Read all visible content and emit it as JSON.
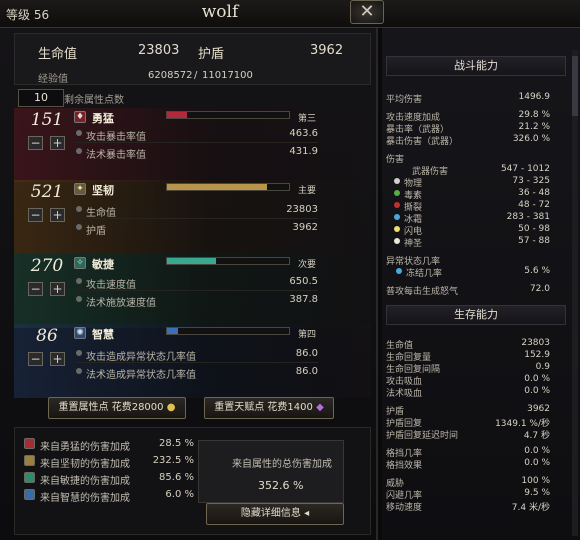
{
  "header": {
    "level_label": "等级 56",
    "char_name": "wolf",
    "close_label": "✕"
  },
  "summary": {
    "hp_label": "生命值",
    "hp_value": "23803",
    "shield_label": "护盾",
    "shield_value": "3962",
    "exp_label": "经验值",
    "exp_value": "6208572",
    "exp_sep": "/",
    "exp_next": "11017100",
    "free_points": "10",
    "free_points_label": "剩余属性点数"
  },
  "attributes": [
    {
      "value": "151",
      "name": "勇猛",
      "rank": "第三",
      "fill": 0.16,
      "color": "#b3283a",
      "icon": "rage-icon",
      "subs": [
        {
          "label": "攻击暴击率值",
          "value": "463.6"
        },
        {
          "label": "法术暴击率值",
          "value": "431.9"
        }
      ]
    },
    {
      "value": "521",
      "name": "坚韧",
      "rank": "主要",
      "fill": 0.82,
      "color": "#b8954a",
      "icon": "fortitude-icon",
      "subs": [
        {
          "label": "生命值",
          "value": "23803"
        },
        {
          "label": "护盾",
          "value": "3962"
        }
      ]
    },
    {
      "value": "270",
      "name": "敏捷",
      "rank": "次要",
      "fill": 0.4,
      "color": "#3aa890",
      "icon": "agility-icon",
      "subs": [
        {
          "label": "攻击速度值",
          "value": "650.5"
        },
        {
          "label": "法术施放速度值",
          "value": "387.8"
        }
      ]
    },
    {
      "value": "86",
      "name": "智慧",
      "rank": "第四",
      "fill": 0.09,
      "color": "#3a70b8",
      "icon": "wisdom-icon",
      "subs": [
        {
          "label": "攻击造成异常状态几率值",
          "value": "86.0"
        },
        {
          "label": "法术造成异常状态几率值",
          "value": "86.0"
        }
      ]
    }
  ],
  "buttons": {
    "reset_attr": "重置属性点 花费28000",
    "reset_talent": "重置天赋点 花费1400",
    "hide_details": "隐藏详细信息"
  },
  "bonus": {
    "rows": [
      {
        "label": "来自勇猛的伤害加成",
        "value": "28.5 %",
        "color": "#a52b35"
      },
      {
        "label": "来自坚韧的伤害加成",
        "value": "232.5 %",
        "color": "#9a8040"
      },
      {
        "label": "来自敏捷的伤害加成",
        "value": "85.6 %",
        "color": "#2f8a6e"
      },
      {
        "label": "来自智慧的伤害加成",
        "value": "6.0 %",
        "color": "#3a6aa8"
      }
    ],
    "total_label": "来自属性的总伤害加成",
    "total_value": "352.6 %"
  },
  "combat": {
    "title": "战斗能力",
    "avg_dmg_label": "平均伤害",
    "avg_dmg_value": "1496.9",
    "atk_speed_label": "攻击速度加成",
    "atk_speed_value": "29.8 %",
    "crit_label": "暴击率（武器）",
    "crit_value": "21.2 %",
    "crit_dmg_label": "暴击伤害（武器）",
    "crit_dmg_value": "326.0 %",
    "dmg_section": "伤害",
    "weapon_dmg_label": "武器伤害",
    "weapon_dmg_value": "547 - 1012",
    "types": [
      {
        "label": "物理",
        "value": "73 - 325",
        "color": "#cfcfcf"
      },
      {
        "label": "毒素",
        "value": "36 - 48",
        "color": "#55b040"
      },
      {
        "label": "撕裂",
        "value": "48 - 72",
        "color": "#c03030"
      },
      {
        "label": "冰霜",
        "value": "283 - 381",
        "color": "#4aa8e0"
      },
      {
        "label": "闪电",
        "value": "50 - 98",
        "color": "#e8e070"
      },
      {
        "label": "神圣",
        "value": "57 - 88",
        "color": "#e8e8d8"
      }
    ],
    "status_section": "异常状态几率",
    "freeze_label": "冻结几率",
    "freeze_value": "5.6 %",
    "rage_label": "普攻每击生成怒气",
    "rage_value": "72.0"
  },
  "survival": {
    "title": "生存能力",
    "rows": [
      {
        "label": "生命值",
        "value": "23803"
      },
      {
        "label": "生命回复量",
        "value": "152.9"
      },
      {
        "label": "生命回复间隔",
        "value": "0.9"
      },
      {
        "label": "攻击吸血",
        "value": "0.0 %"
      },
      {
        "label": "法术吸血",
        "value": "0.0 %"
      }
    ],
    "rows2": [
      {
        "label": "护盾",
        "value": "3962"
      },
      {
        "label": "护盾回复",
        "value": "1349.1 %/秒"
      },
      {
        "label": "护盾回复延迟时间",
        "value": "4.7 秒"
      }
    ],
    "rows3": [
      {
        "label": "格挡几率",
        "value": "0.0 %"
      },
      {
        "label": "格挡效果",
        "value": "0.0 %"
      }
    ],
    "rows4": [
      {
        "label": "威胁",
        "value": "100 %"
      },
      {
        "label": "闪避几率",
        "value": "9.5 %"
      },
      {
        "label": "移动速度",
        "value": "7.4 米/秒"
      }
    ]
  },
  "colors": {
    "accent": "#6f6650",
    "panel": "#141316"
  }
}
